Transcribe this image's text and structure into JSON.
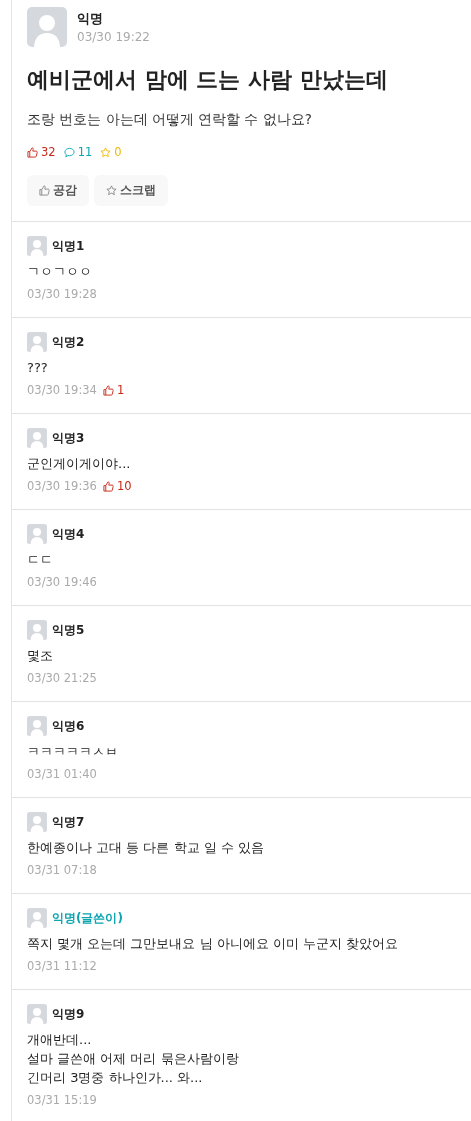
{
  "post": {
    "author": "익명",
    "time": "03/30 19:22",
    "title": "예비군에서 맘에 드는 사람 만났는데",
    "body": "조랑 번호는 아는데 어떻게 연락할 수 없나요?",
    "likes": "32",
    "comments": "11",
    "scraps": "0",
    "buttons": [
      "공감",
      "스크랩"
    ]
  },
  "comments": [
    {
      "author": "익명1",
      "writer": false,
      "lines": [
        "ㄱㅇㄱㅇㅇ"
      ],
      "time": "03/30 19:28"
    },
    {
      "author": "익명2",
      "writer": false,
      "lines": [
        "???"
      ],
      "time": "03/30 19:34",
      "likes": "1"
    },
    {
      "author": "익명3",
      "writer": false,
      "lines": [
        "군인게이게이야..."
      ],
      "time": "03/30 19:36",
      "likes": "10"
    },
    {
      "author": "익명4",
      "writer": false,
      "lines": [
        "ㄷㄷ"
      ],
      "time": "03/30 19:46"
    },
    {
      "author": "익명5",
      "writer": false,
      "lines": [
        "몇조"
      ],
      "time": "03/30 21:25"
    },
    {
      "author": "익명6",
      "writer": false,
      "lines": [
        "ㅋㅋㅋㅋㅋㅅㅂ"
      ],
      "time": "03/31 01:40"
    },
    {
      "author": "익명7",
      "writer": false,
      "lines": [
        "한예종이나 고대 등 다른 학교 일 수 있음"
      ],
      "time": "03/31 07:18"
    },
    {
      "author": "익명(글쓴이)",
      "writer": true,
      "lines": [
        "쪽지 몇개 오는데 그만보내요 님 아니에요 이미 누군지 찾았어요"
      ],
      "time": "03/31 11:12"
    },
    {
      "author": "익명9",
      "writer": false,
      "lines": [
        "개애반데...",
        "설마 글쓴애 어제 머리 묶은사람이랑",
        "긴머리 3명중 하나인가... 와..."
      ],
      "time": "03/31 15:19"
    }
  ]
}
